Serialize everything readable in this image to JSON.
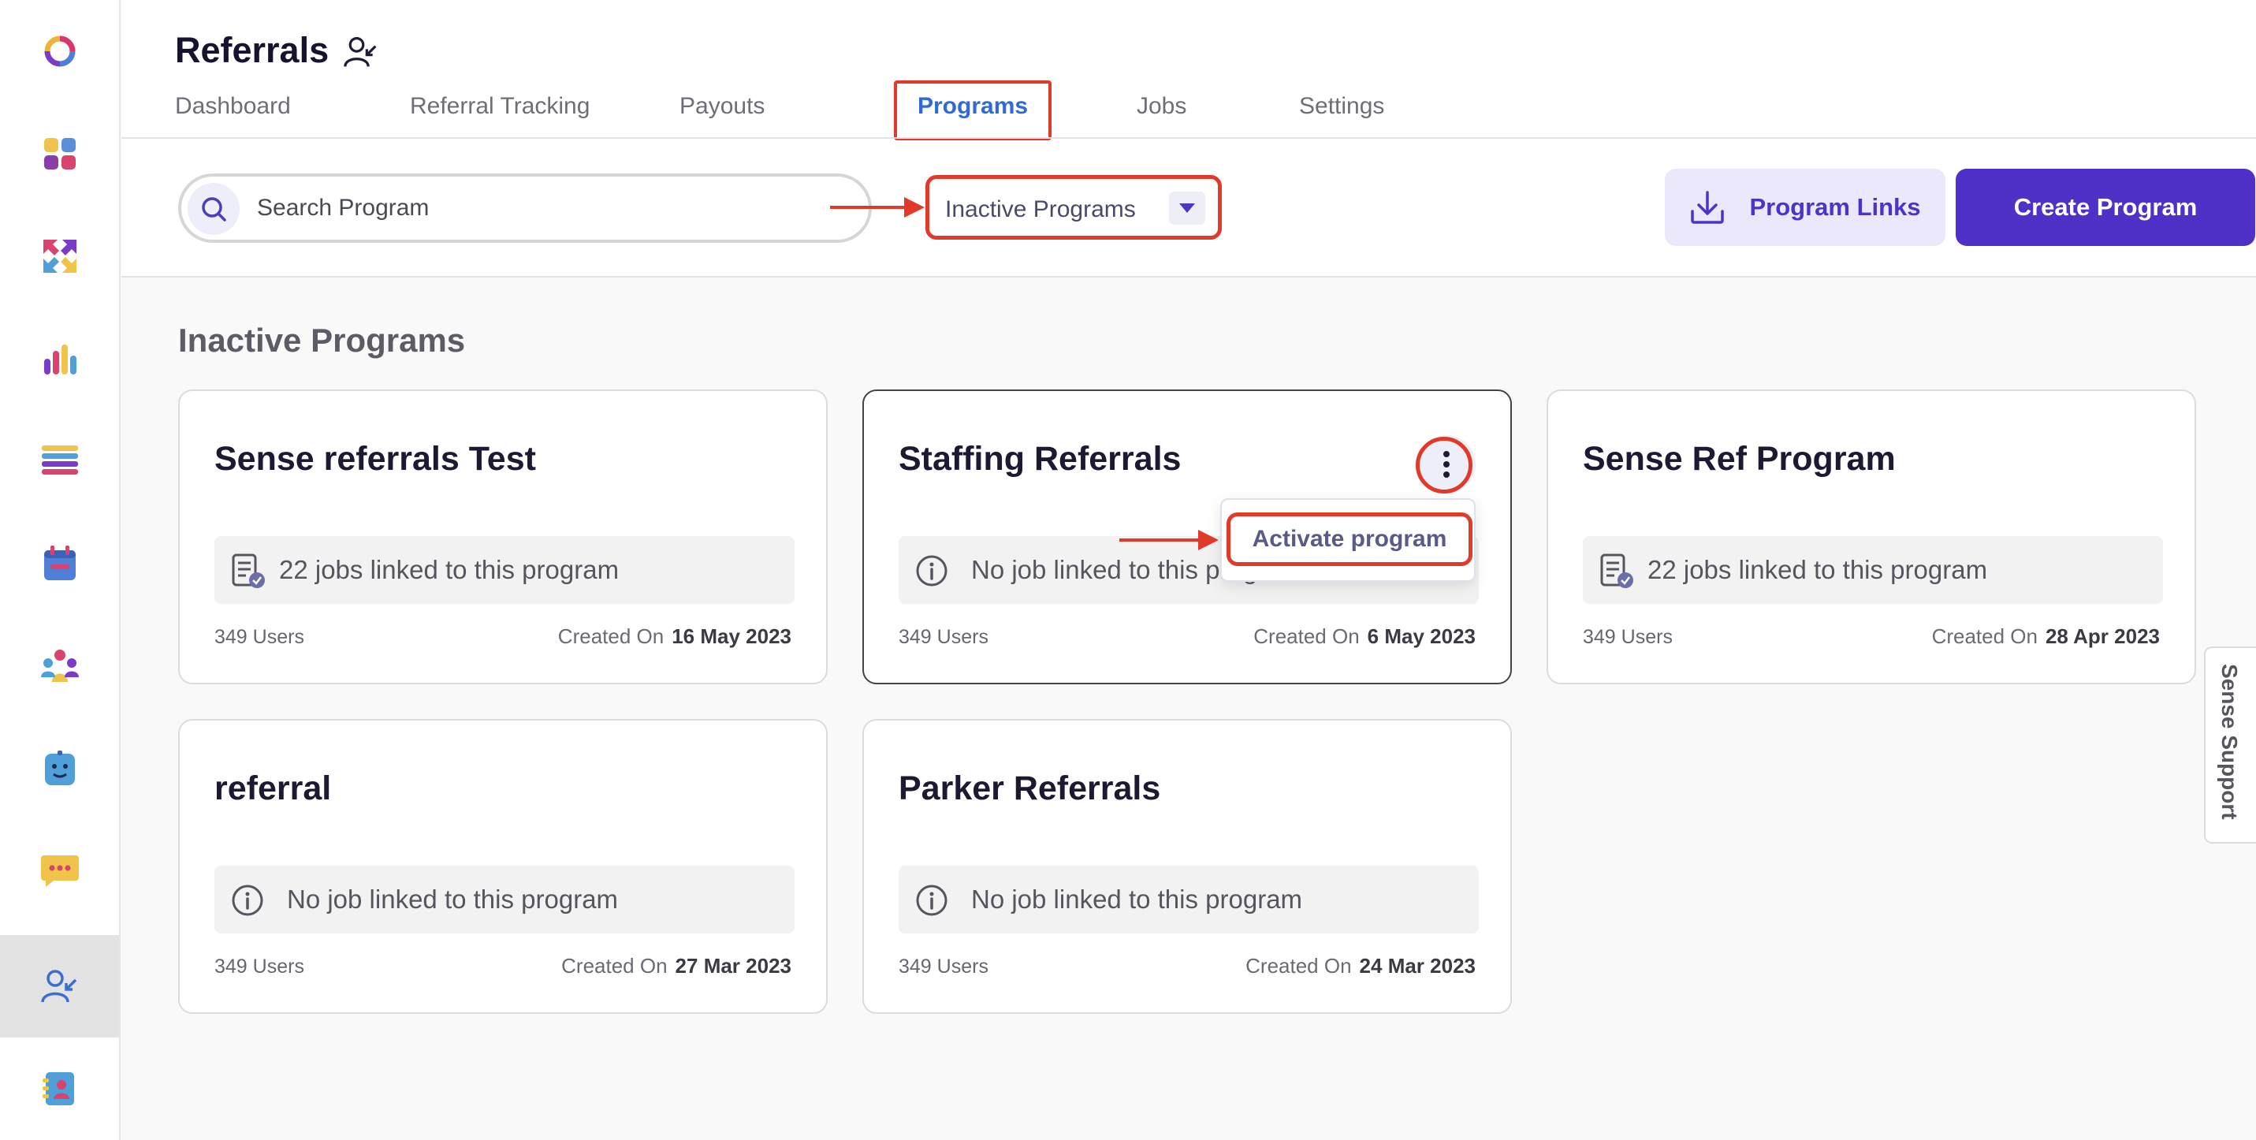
{
  "app": {
    "title": "Referrals",
    "title_icon": "user-referral-icon"
  },
  "sidebar": {
    "items": [
      {
        "icon": "logo-ring-icon",
        "active": false
      },
      {
        "icon": "dashboard-grid-icon",
        "active": false
      },
      {
        "icon": "arrows-exchange-icon",
        "active": false
      },
      {
        "icon": "bar-chart-icon",
        "active": false
      },
      {
        "icon": "list-stack-icon",
        "active": false
      },
      {
        "icon": "calendar-icon",
        "active": false
      },
      {
        "icon": "team-icon",
        "active": false
      },
      {
        "icon": "chatbot-icon",
        "active": false
      },
      {
        "icon": "chat-bubble-icon",
        "active": false
      },
      {
        "icon": "user-referral-icon",
        "active": true
      },
      {
        "icon": "contacts-book-icon",
        "active": false
      }
    ]
  },
  "tabs": [
    {
      "label": "Dashboard",
      "active": false
    },
    {
      "label": "Referral Tracking",
      "active": false
    },
    {
      "label": "Payouts",
      "active": false
    },
    {
      "label": "Programs",
      "active": true
    },
    {
      "label": "Jobs",
      "active": false
    },
    {
      "label": "Settings",
      "active": false
    }
  ],
  "toolbar": {
    "search_placeholder": "Search Program",
    "filter_value": "Inactive Programs",
    "program_links_label": "Program Links",
    "create_program_label": "Create Program"
  },
  "section": {
    "title": "Inactive Programs"
  },
  "cards": [
    {
      "title": "Sense referrals Test",
      "info": "22 jobs linked to this program",
      "info_icon": "document-check-icon",
      "users": "349 Users",
      "created_label": "Created On",
      "created_date": "16 May 2023"
    },
    {
      "title": "Staffing Referrals",
      "info": "No job linked to this program",
      "info_icon": "info-icon",
      "users": "349 Users",
      "created_label": "Created On",
      "created_date": "6 May 2023"
    },
    {
      "title": "Sense Ref Program",
      "info": "22 jobs linked to this program",
      "info_icon": "document-check-icon",
      "users": "349 Users",
      "created_label": "Created On",
      "created_date": "28 Apr 2023"
    },
    {
      "title": "referral",
      "info": "No job linked to this program",
      "info_icon": "info-icon",
      "users": "349 Users",
      "created_label": "Created On",
      "created_date": "27 Mar 2023"
    },
    {
      "title": "Parker Referrals",
      "info": "No job linked to this program",
      "info_icon": "info-icon",
      "users": "349 Users",
      "created_label": "Created On",
      "created_date": "24 Mar 2023"
    }
  ],
  "context_menu": {
    "item_label": "Activate program"
  },
  "support": {
    "label": "Sense Support"
  },
  "colors": {
    "accent": "#5031c8",
    "active_tab": "#2f6bd6",
    "annotation": "#e23a2a"
  }
}
